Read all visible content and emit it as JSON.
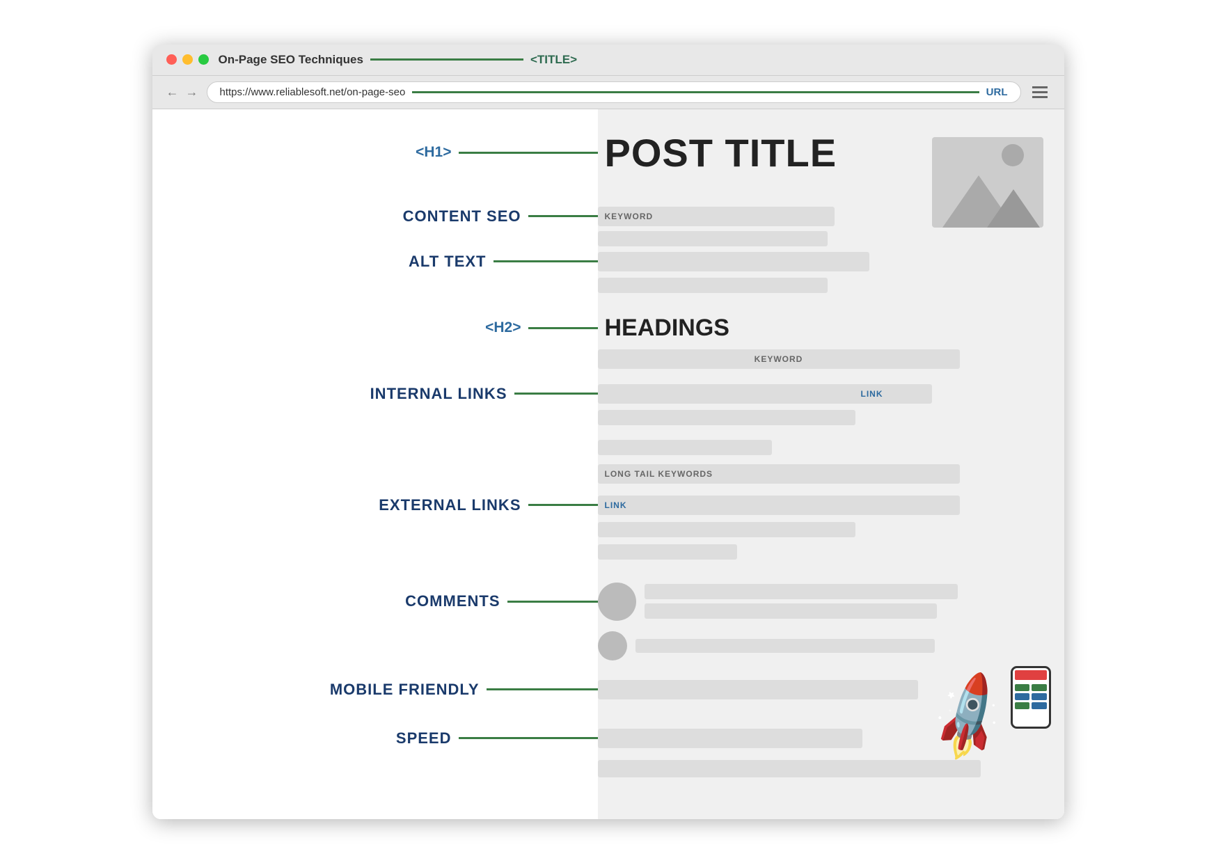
{
  "browser": {
    "title": "On-Page SEO Techniques",
    "title_tag": "<TITLE>",
    "url": "https://www.reliablesoft.net/on-page-seo",
    "url_label": "URL"
  },
  "webpage": {
    "post_title": "POST TITLE",
    "h1_label": "<H1>",
    "h2_label": "<H2>",
    "headings_text": "HEADINGS"
  },
  "labels": {
    "content_seo": "CONTENT SEO",
    "alt_text": "ALT TEXT",
    "internal_links": "INTERNAL LINKS",
    "external_links": "EXTERNAL LINKS",
    "comments": "COMMENTS",
    "mobile_friendly": "MOBILE FRIENDLY",
    "speed": "SPEED"
  },
  "tags": {
    "keyword": "KEYWORD",
    "link": "LINK",
    "long_tail_keywords": "LONG TAIL KEYWORDS"
  },
  "colors": {
    "green": "#3a7d44",
    "blue_label": "#1a3a6b",
    "link_blue": "#2d6a9f",
    "gray_bar": "#ddd",
    "dark_gray": "#bbb"
  }
}
